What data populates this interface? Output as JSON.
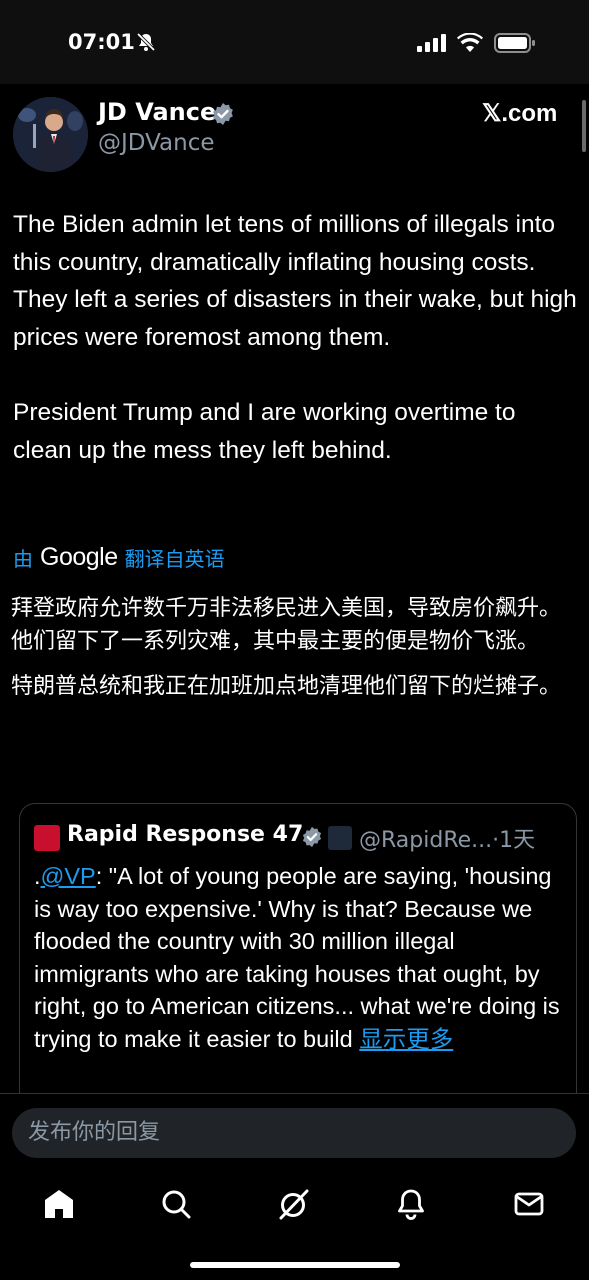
{
  "status_bar": {
    "time": "07:01"
  },
  "post": {
    "author_name": "JD Vance",
    "author_handle": "@JDVance",
    "brand": "𝕏.com",
    "text_paragraphs": [
      "The Biden admin let tens of millions of illegals into this country, dramatically inflating housing costs. They left a series of disasters in their wake, but high prices were foremost among them.",
      "President Trump and I are working overtime to clean up the mess they left behind."
    ],
    "translation": {
      "prefix": "由",
      "provider": "Google",
      "suffix": "翻译自英语",
      "paragraphs": [
        "拜登政府允许数千万非法移民进入美国，导致房价飙升。他们留下了一系列灾难，其中最主要的便是物价飞涨。",
        "特朗普总统和我正在加班加点地清理他们留下的烂摊子。"
      ]
    }
  },
  "quote": {
    "logo_text": "RAPID RESPONSE",
    "name": "Rapid Response 47",
    "affiliate_badge_text": "THE WHITE HOUSE",
    "meta": "@RapidRe...·1天",
    "lead": ".",
    "mention": "@VP",
    "text": ": \"A lot of young people are saying, 'housing is way too expensive.' Why is that? Because we flooded the country with 30 million illegal immigrants who are taking houses that ought, by right, go to American citizens... what we're doing is trying to make it easier to build ",
    "show_more": "显示更多"
  },
  "reply": {
    "placeholder": "发布你的回复"
  },
  "nav": {
    "items": [
      "home-icon",
      "search-icon",
      "grok-icon",
      "notifications-icon",
      "messages-icon"
    ]
  },
  "colors": {
    "accent": "#1d9bf0",
    "background": "#000000",
    "muted": "#8b98a5"
  }
}
